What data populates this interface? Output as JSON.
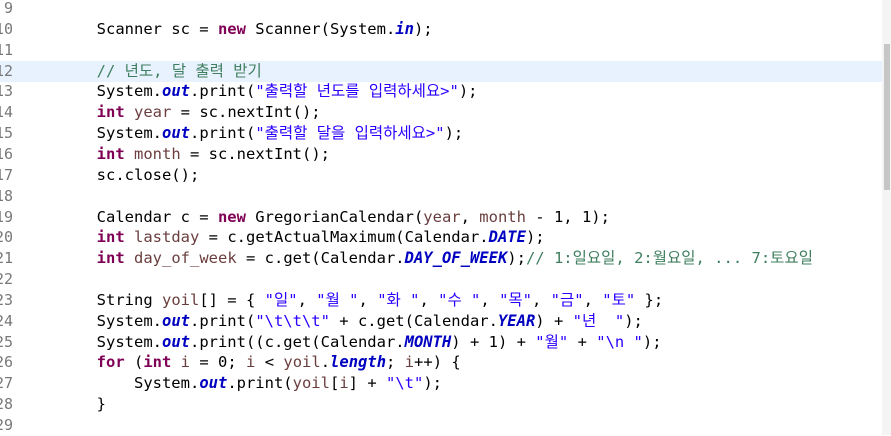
{
  "editor": {
    "lines": [
      {
        "n": "9",
        "segs": []
      },
      {
        "n": "10",
        "segs": [
          [
            "p",
            "        Scanner sc = "
          ],
          [
            "kw",
            "new"
          ],
          [
            "p",
            " Scanner(System."
          ],
          [
            "fld",
            "in"
          ],
          [
            "p",
            ");"
          ]
        ]
      },
      {
        "n": "11",
        "segs": []
      },
      {
        "n": "12",
        "current": true,
        "segs": [
          [
            "p",
            "        "
          ],
          [
            "cm",
            "// 년도, 달 출력 받기"
          ]
        ]
      },
      {
        "n": "13",
        "segs": [
          [
            "p",
            "        System."
          ],
          [
            "fld",
            "out"
          ],
          [
            "p",
            ".print("
          ],
          [
            "str",
            "\"출력할 년도를 입력하세요>\""
          ],
          [
            "p",
            ");"
          ]
        ]
      },
      {
        "n": "14",
        "segs": [
          [
            "p",
            "        "
          ],
          [
            "kw",
            "int"
          ],
          [
            "p",
            " "
          ],
          [
            "lv",
            "year"
          ],
          [
            "p",
            " = sc.nextInt();"
          ]
        ]
      },
      {
        "n": "15",
        "segs": [
          [
            "p",
            "        System."
          ],
          [
            "fld",
            "out"
          ],
          [
            "p",
            ".print("
          ],
          [
            "str",
            "\"출력할 달을 입력하세요>\""
          ],
          [
            "p",
            ");"
          ]
        ]
      },
      {
        "n": "16",
        "segs": [
          [
            "p",
            "        "
          ],
          [
            "kw",
            "int"
          ],
          [
            "p",
            " "
          ],
          [
            "lv",
            "month"
          ],
          [
            "p",
            " = sc.nextInt();"
          ]
        ]
      },
      {
        "n": "17",
        "segs": [
          [
            "p",
            "        sc.close();"
          ]
        ]
      },
      {
        "n": "18",
        "segs": []
      },
      {
        "n": "19",
        "segs": [
          [
            "p",
            "        Calendar c = "
          ],
          [
            "kw",
            "new"
          ],
          [
            "p",
            " GregorianCalendar("
          ],
          [
            "lv",
            "year"
          ],
          [
            "p",
            ", "
          ],
          [
            "lv",
            "month"
          ],
          [
            "p",
            " - 1, 1);"
          ]
        ]
      },
      {
        "n": "20",
        "segs": [
          [
            "p",
            "        "
          ],
          [
            "kw",
            "int"
          ],
          [
            "p",
            " "
          ],
          [
            "lv",
            "lastday"
          ],
          [
            "p",
            " = c.getActualMaximum(Calendar."
          ],
          [
            "fld",
            "DATE"
          ],
          [
            "p",
            ");"
          ]
        ]
      },
      {
        "n": "21",
        "segs": [
          [
            "p",
            "        "
          ],
          [
            "kw",
            "int"
          ],
          [
            "p",
            " "
          ],
          [
            "lv",
            "day_of_week"
          ],
          [
            "p",
            " = c.get(Calendar."
          ],
          [
            "fld",
            "DAY_OF_WEEK"
          ],
          [
            "p",
            ");"
          ],
          [
            "cm",
            "// 1:일요일, 2:월요일, ... 7:토요일"
          ]
        ]
      },
      {
        "n": "22",
        "segs": []
      },
      {
        "n": "23",
        "segs": [
          [
            "p",
            "        String "
          ],
          [
            "lv",
            "yoil"
          ],
          [
            "p",
            "[] = { "
          ],
          [
            "str",
            "\"일\""
          ],
          [
            "p",
            ", "
          ],
          [
            "str",
            "\"월 \""
          ],
          [
            "p",
            ", "
          ],
          [
            "str",
            "\"화 \""
          ],
          [
            "p",
            ", "
          ],
          [
            "str",
            "\"수 \""
          ],
          [
            "p",
            ", "
          ],
          [
            "str",
            "\"목\""
          ],
          [
            "p",
            ", "
          ],
          [
            "str",
            "\"금\""
          ],
          [
            "p",
            ", "
          ],
          [
            "str",
            "\"토\""
          ],
          [
            "p",
            " };"
          ]
        ]
      },
      {
        "n": "24",
        "segs": [
          [
            "p",
            "        System."
          ],
          [
            "fld",
            "out"
          ],
          [
            "p",
            ".print("
          ],
          [
            "str",
            "\"\\t\\t\\t\""
          ],
          [
            "p",
            " + c.get(Calendar."
          ],
          [
            "fld",
            "YEAR"
          ],
          [
            "p",
            ") + "
          ],
          [
            "str",
            "\"년  \""
          ],
          [
            "p",
            ");"
          ]
        ]
      },
      {
        "n": "25",
        "segs": [
          [
            "p",
            "        System."
          ],
          [
            "fld",
            "out"
          ],
          [
            "p",
            ".print((c.get(Calendar."
          ],
          [
            "fld",
            "MONTH"
          ],
          [
            "p",
            ") + 1) + "
          ],
          [
            "str",
            "\"월\""
          ],
          [
            "p",
            " + "
          ],
          [
            "str",
            "\"\\n \""
          ],
          [
            "p",
            ");"
          ]
        ]
      },
      {
        "n": "26",
        "segs": [
          [
            "p",
            "        "
          ],
          [
            "kw",
            "for"
          ],
          [
            "p",
            " ("
          ],
          [
            "kw",
            "int"
          ],
          [
            "p",
            " "
          ],
          [
            "lv",
            "i"
          ],
          [
            "p",
            " = 0; "
          ],
          [
            "lv",
            "i"
          ],
          [
            "p",
            " < "
          ],
          [
            "lv",
            "yoil"
          ],
          [
            "p",
            "."
          ],
          [
            "fld",
            "length"
          ],
          [
            "p",
            "; "
          ],
          [
            "lv",
            "i"
          ],
          [
            "p",
            "++) {"
          ]
        ]
      },
      {
        "n": "27",
        "segs": [
          [
            "p",
            "            System."
          ],
          [
            "fld",
            "out"
          ],
          [
            "p",
            ".print("
          ],
          [
            "lv",
            "yoil"
          ],
          [
            "p",
            "["
          ],
          [
            "lv",
            "i"
          ],
          [
            "p",
            "] + "
          ],
          [
            "str",
            "\"\\t\""
          ],
          [
            "p",
            ");"
          ]
        ]
      },
      {
        "n": "28",
        "segs": [
          [
            "p",
            "        }"
          ]
        ]
      },
      {
        "n": "29",
        "segs": []
      }
    ]
  }
}
